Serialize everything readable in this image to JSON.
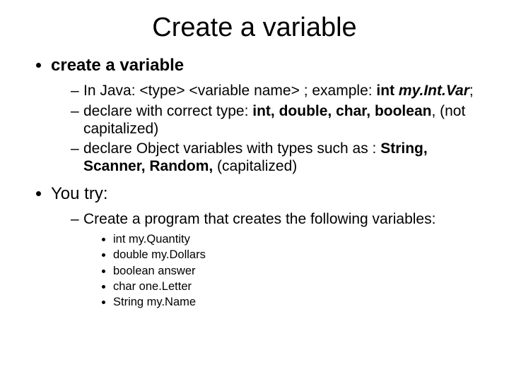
{
  "title": "Create a variable",
  "items": [
    {
      "label": "create a variable",
      "heavy": true,
      "sub": [
        {
          "prefix": "In Java: <type> <variable name> ;  example: ",
          "bold1": "int",
          "mid": " ",
          "italic": "my.Int.Var",
          "suffix": ";"
        },
        {
          "prefix": "declare with correct type: ",
          "bold1": "int, double, char, boolean",
          "suffix": ", (not capitalized)"
        },
        {
          "prefix": "declare Object variables with types such as : ",
          "bold1": "String, Scanner, Random,",
          "suffix": " (capitalized)"
        }
      ]
    },
    {
      "label": "You try:",
      "heavy": false,
      "sub": [
        {
          "prefix": "Create a program that creates the following variables:",
          "list": [
            "int my.Quantity",
            "double my.Dollars",
            "boolean answer",
            " char one.Letter",
            "String my.Name"
          ]
        }
      ]
    }
  ]
}
